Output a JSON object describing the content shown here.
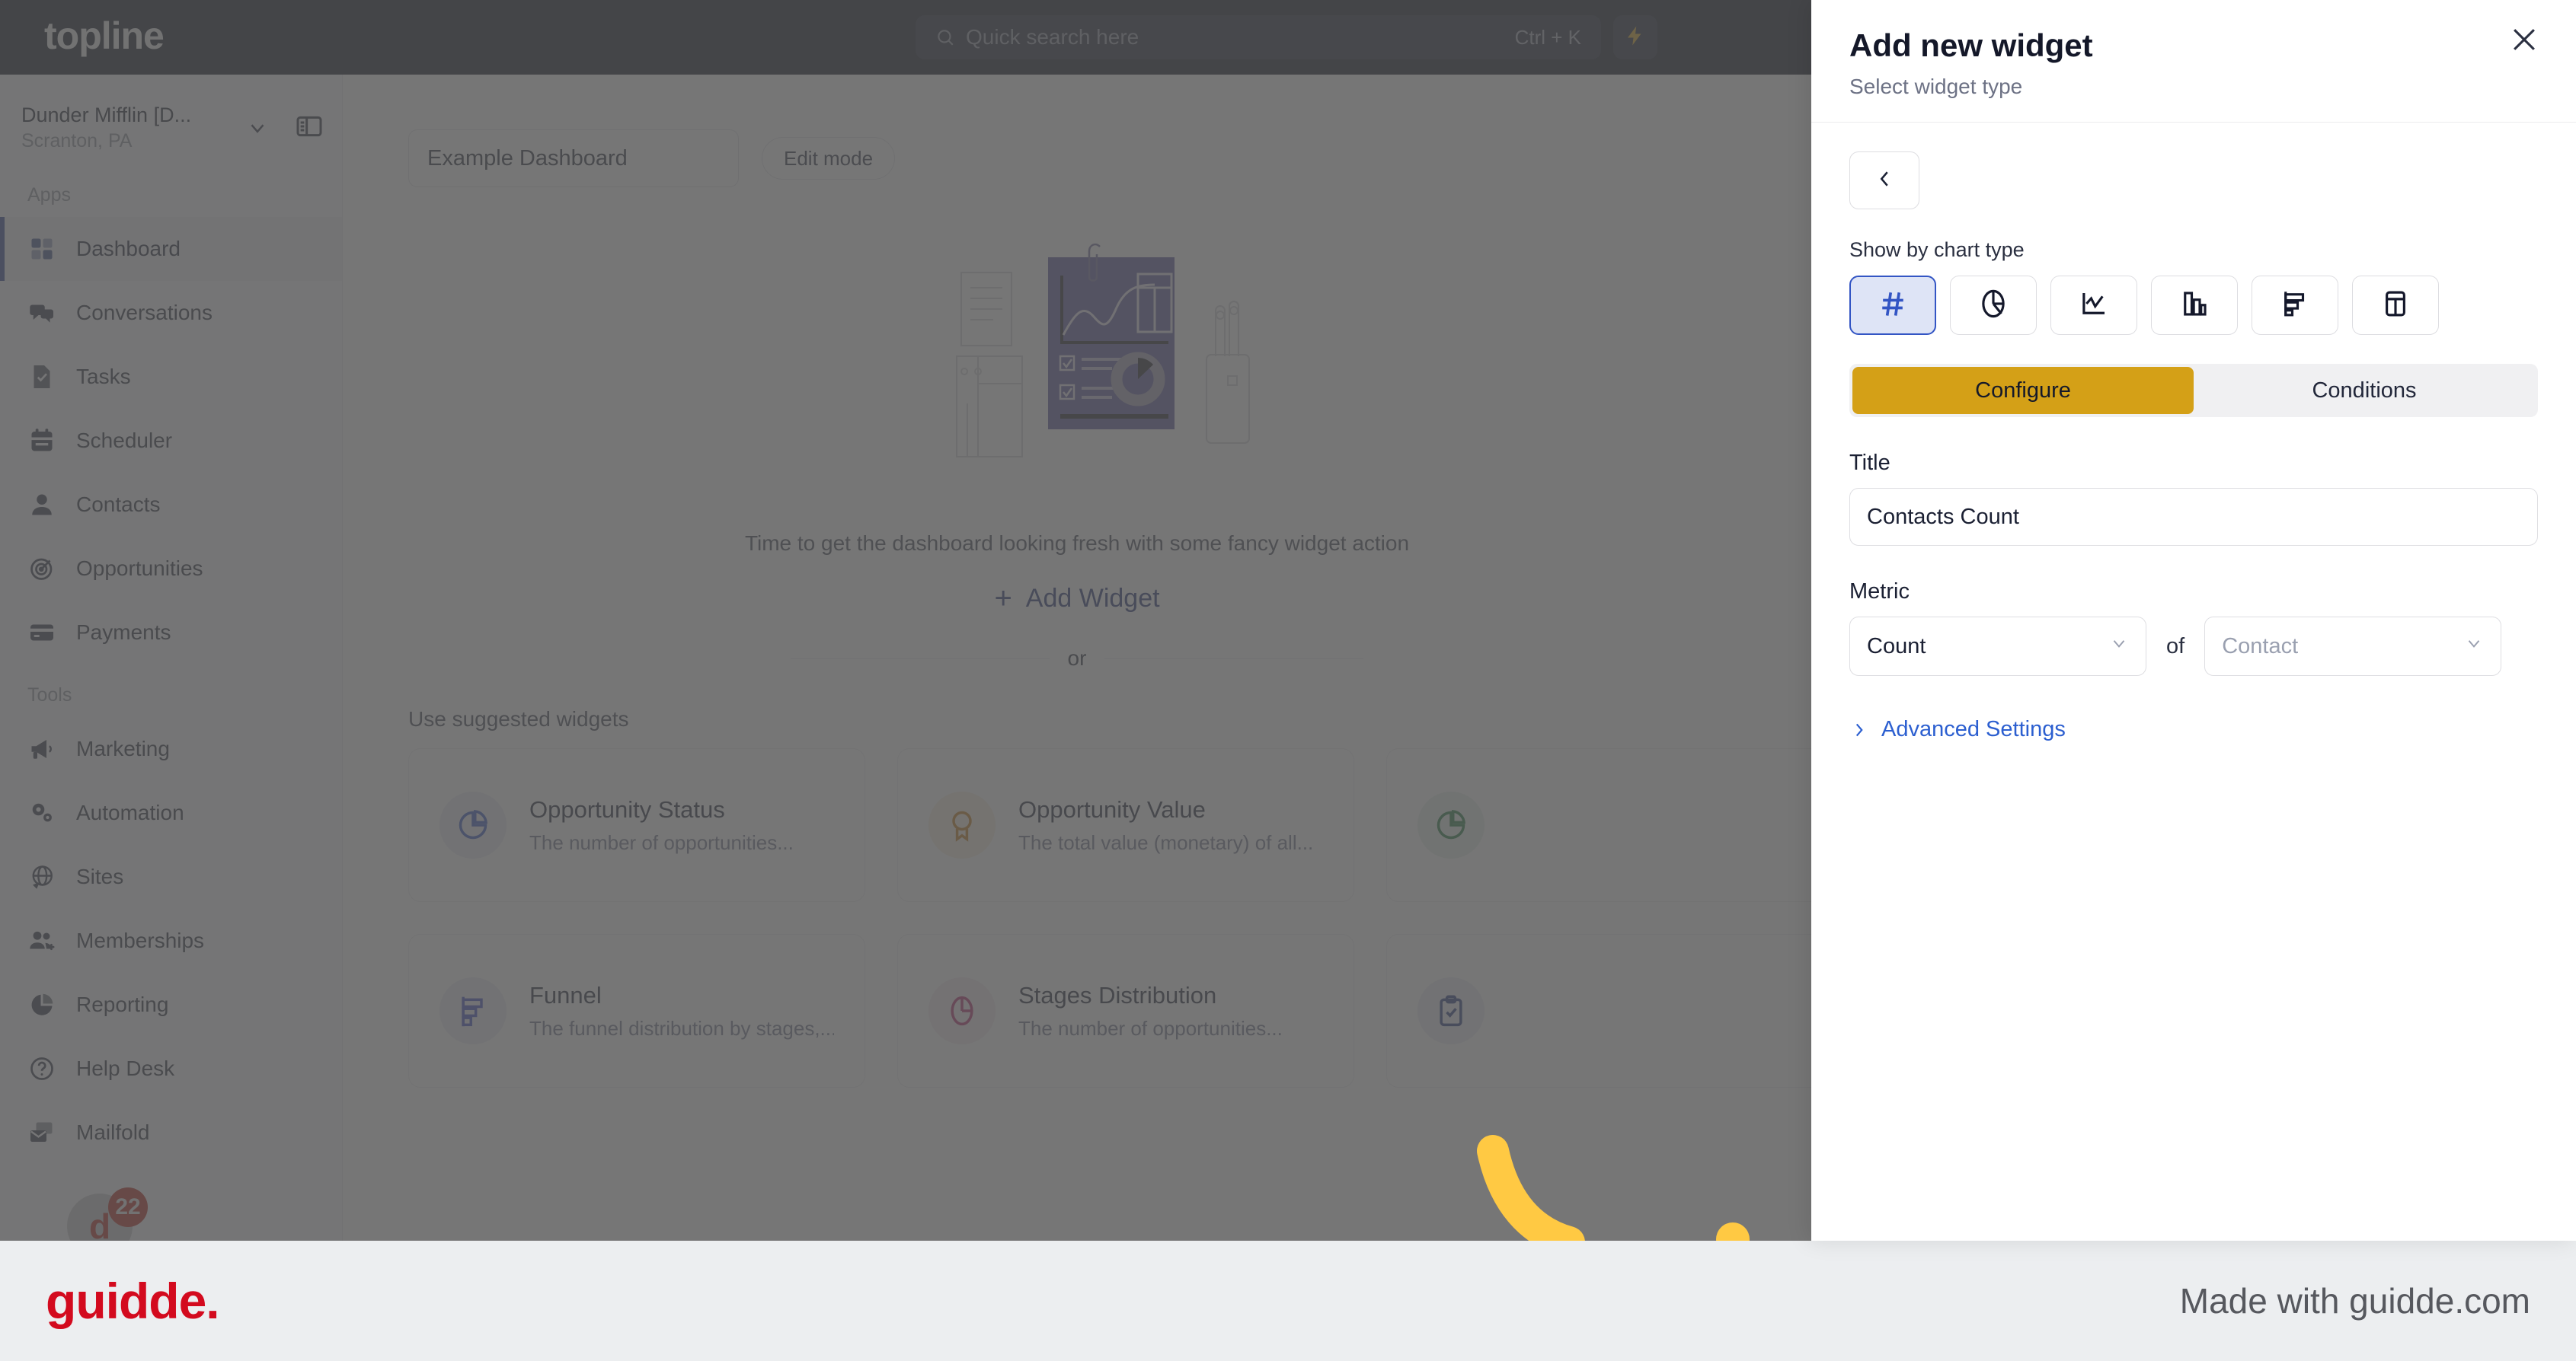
{
  "topbar": {
    "logo": "topline",
    "search_placeholder": "Quick search here",
    "search_shortcut": "Ctrl + K",
    "bolt_icon": "lightning-bolt-icon"
  },
  "sidebar": {
    "org_name": "Dunder Mifflin [D...",
    "org_location": "Scranton, PA",
    "groups": [
      {
        "label": "Apps",
        "items": [
          {
            "label": "Dashboard",
            "icon": "puzzle-icon",
            "active": true
          },
          {
            "label": "Conversations",
            "icon": "chat-bubbles-icon",
            "active": false
          },
          {
            "label": "Tasks",
            "icon": "document-check-icon",
            "active": false
          },
          {
            "label": "Scheduler",
            "icon": "calendar-icon",
            "active": false
          },
          {
            "label": "Contacts",
            "icon": "person-icon",
            "active": false
          },
          {
            "label": "Opportunities",
            "icon": "target-icon",
            "active": false
          },
          {
            "label": "Payments",
            "icon": "credit-card-icon",
            "active": false
          }
        ]
      },
      {
        "label": "Tools",
        "items": [
          {
            "label": "Marketing",
            "icon": "megaphone-icon",
            "active": false
          },
          {
            "label": "Automation",
            "icon": "gears-icon",
            "active": false
          },
          {
            "label": "Sites",
            "icon": "globe-cursor-icon",
            "active": false
          },
          {
            "label": "Memberships",
            "icon": "people-plus-icon",
            "active": false
          },
          {
            "label": "Reporting",
            "icon": "pie-chart-icon",
            "active": false
          },
          {
            "label": "Help Desk",
            "icon": "question-circle-icon",
            "active": false
          },
          {
            "label": "Mailfold",
            "icon": "mail-stack-icon",
            "active": false
          }
        ]
      }
    ],
    "avatar_initial": "d",
    "badge_count": "22"
  },
  "dashboard": {
    "title_value": "Example Dashboard",
    "edit_mode_label": "Edit mode",
    "empty_caption": "Time to get the dashboard looking fresh with some fancy widget action",
    "add_widget_label": "Add Widget",
    "add_widget_plus": "+",
    "or_label": "or",
    "suggested_label": "Use suggested widgets",
    "suggested_widgets": [
      {
        "title": "Opportunity Status",
        "desc": "The number of opportunities...",
        "icon": "pie-chart-icon",
        "color": "#2f4fc0"
      },
      {
        "title": "Opportunity Value",
        "desc": "The total value (monetary) of all...",
        "icon": "award-ribbon-icon",
        "color": "#c47a15"
      },
      {
        "title": "",
        "desc": "",
        "icon": "pie-chart-icon",
        "color": "#1f7a3d"
      },
      {
        "title": "Funnel",
        "desc": "The funnel distribution by stages,...",
        "icon": "funnel-bars-icon",
        "color": "#3b48c4"
      },
      {
        "title": "Stages Distribution",
        "desc": "The number of opportunities...",
        "icon": "pie-slice-icon",
        "color": "#b5266b"
      },
      {
        "title": "",
        "desc": "",
        "icon": "clipboard-check-icon",
        "color": "#21347e"
      }
    ]
  },
  "panel": {
    "title": "Add new widget",
    "subtitle": "Select widget type",
    "close_icon": "close-icon",
    "back_icon": "chevron-left-icon",
    "chart_type_label": "Show by chart type",
    "chart_types": [
      {
        "name": "number",
        "icon": "hash-icon",
        "selected": true
      },
      {
        "name": "pie",
        "icon": "pie-chart-icon",
        "selected": false
      },
      {
        "name": "line",
        "icon": "line-chart-icon",
        "selected": false
      },
      {
        "name": "column",
        "icon": "column-chart-icon",
        "selected": false
      },
      {
        "name": "bar",
        "icon": "bar-chart-icon",
        "selected": false
      },
      {
        "name": "table",
        "icon": "table-icon",
        "selected": false
      }
    ],
    "tabs": [
      {
        "label": "Configure",
        "active": true
      },
      {
        "label": "Conditions",
        "active": false
      }
    ],
    "title_field_label": "Title",
    "title_field_value": "Contacts Count",
    "metric_field_label": "Metric",
    "metric_function_value": "Count",
    "metric_of_label": "of",
    "metric_entity_placeholder": "Contact",
    "advanced_settings_label": "Advanced Settings",
    "accent_selected": "#3355c4",
    "accent_tab": "#d4a017"
  },
  "footer": {
    "logo": "guidde.",
    "made_with": "Made with guidde.com"
  }
}
